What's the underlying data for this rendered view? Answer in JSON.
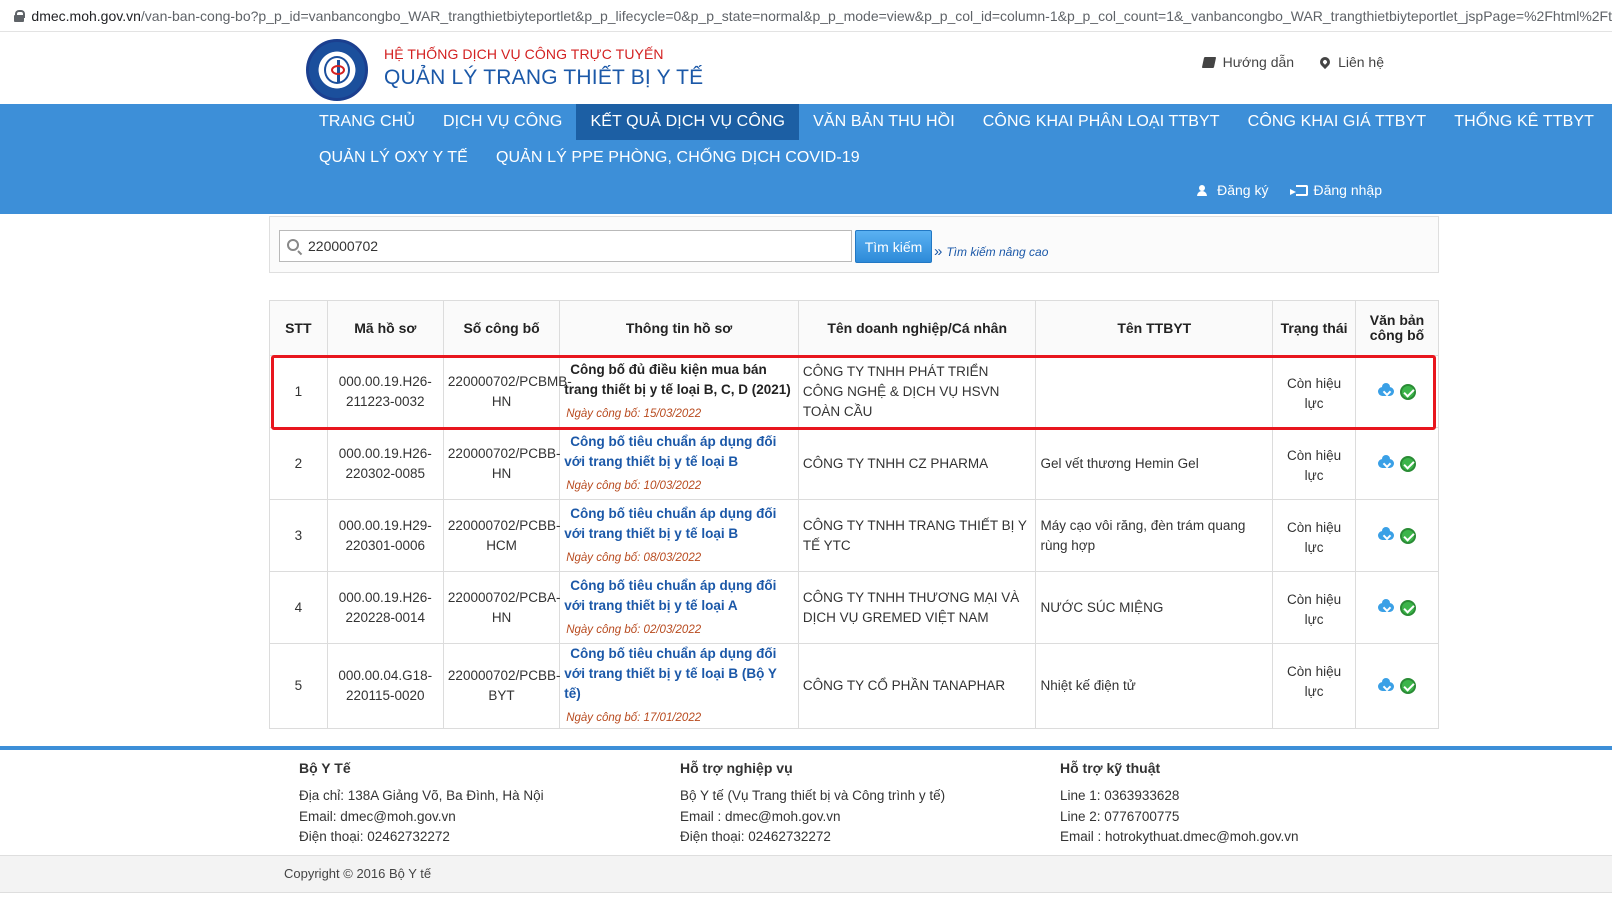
{
  "browser": {
    "url_domain": "dmec.moh.gov.vn",
    "url_rest": "/van-ban-cong-bo?p_p_id=vanbancongbo_WAR_trangthietbiyteportlet&p_p_lifecycle=0&p_p_state=normal&p_p_mode=view&p_p_col_id=column-1&p_p_col_count=1&_vanbancongbo_WAR_trangthietbiyteportlet_jspPage=%2Fhtml%2Ft"
  },
  "header": {
    "subtitle": "HỆ THỐNG DỊCH VỤ CÔNG TRỰC TUYẾN",
    "title": "QUẢN LÝ TRANG THIẾT BỊ Y TẾ",
    "guide": "Hướng dẫn",
    "contact": "Liên hệ"
  },
  "nav": {
    "row1": [
      "TRANG CHỦ",
      "DỊCH VỤ CÔNG",
      "KẾT QUẢ DỊCH VỤ CÔNG",
      "VĂN BẢN THU HỒI",
      "CÔNG KHAI PHÂN LOẠI TTBYT",
      "CÔNG KHAI GIÁ TTBYT",
      "THỐNG KÊ TTBYT"
    ],
    "row2": [
      "QUẢN LÝ OXY Y TẾ",
      "QUẢN LÝ PPE PHÒNG, CHỐNG DỊCH COVID-19"
    ],
    "active": "KẾT QUẢ DỊCH VỤ CÔNG",
    "register": "Đăng ký",
    "login": "Đăng nhập"
  },
  "search": {
    "value": "220000702",
    "button": "Tìm kiếm",
    "advanced": "Tìm kiếm nâng cao"
  },
  "table": {
    "headers": [
      "STT",
      "Mã hồ sơ",
      "Số công bố",
      "Thông tin hồ sơ",
      "Tên doanh nghiệp/Cá nhân",
      "Tên TTBYT",
      "Trạng thái",
      "Văn bản công bố"
    ],
    "rows": [
      {
        "stt": "1",
        "ma": "000.00.19.H26-211223-0032",
        "so": "220000702/PCBMB-HN",
        "title": "Công bố đủ điều kiện mua bán trang thiết bị y tế loại B, C, D (2021)",
        "date": "Ngày công bố: 15/03/2022",
        "company": "CÔNG TY TNHH PHÁT TRIỂN CÔNG NGHỆ & DỊCH VỤ HSVN TOÀN CẦU",
        "device": "",
        "status": "Còn hiệu lực"
      },
      {
        "stt": "2",
        "ma": "000.00.19.H26-220302-0085",
        "so": "220000702/PCBB-HN",
        "title": "Công bố tiêu chuẩn áp dụng đối với trang thiết bị y tế loại B",
        "date": "Ngày công bố: 10/03/2022",
        "company": "CÔNG TY TNHH CZ PHARMA",
        "device": "Gel vết thương Hemin Gel",
        "status": "Còn hiệu lực"
      },
      {
        "stt": "3",
        "ma": "000.00.19.H29-220301-0006",
        "so": "220000702/PCBB-HCM",
        "title": "Công bố tiêu chuẩn áp dụng đối với trang thiết bị y tế loại B",
        "date": "Ngày công bố: 08/03/2022",
        "company": "CÔNG TY TNHH TRANG THIẾT BỊ Y TẾ YTC",
        "device": "Máy cạo vôi răng, đèn trám quang rùng hợp",
        "status": "Còn hiệu lực"
      },
      {
        "stt": "4",
        "ma": "000.00.19.H26-220228-0014",
        "so": "220000702/PCBA-HN",
        "title": "Công bố tiêu chuẩn áp dụng đối với trang thiết bị y tế loại A",
        "date": "Ngày công bố: 02/03/2022",
        "company": "CÔNG TY TNHH THƯƠNG MẠI VÀ DỊCH VỤ GREMED VIỆT NAM",
        "device": "NƯỚC SÚC MIỆNG",
        "status": "Còn hiệu lực"
      },
      {
        "stt": "5",
        "ma": "000.00.04.G18-220115-0020",
        "so": "220000702/PCBB-BYT",
        "title": "Công bố tiêu chuẩn áp dụng đối với trang thiết bị y tế loại B (Bộ Y tế)",
        "date": "Ngày công bố: 17/01/2022",
        "company": "CÔNG TY CỔ PHẦN TANAPHAR",
        "device": "Nhiệt kế điện tử",
        "status": "Còn hiệu lực"
      }
    ]
  },
  "footer": {
    "col1": {
      "title": "Bộ Y Tế",
      "lines": [
        "Địa chỉ: 138A Giảng Võ, Ba Đình, Hà Nội",
        "Email: dmec@moh.gov.vn",
        "Điện thoại: 02462732272"
      ]
    },
    "col2": {
      "title": "Hỗ trợ nghiệp vụ",
      "lines": [
        "Bộ Y tế (Vụ Trang thiết bị và Công trình y tế)",
        "Email : dmec@moh.gov.vn",
        "Điện thoại: 02462732272"
      ]
    },
    "col3": {
      "title": "Hỗ trợ kỹ thuật",
      "lines": [
        "Line 1: 0363933628",
        "Line 2: 0776700775",
        "Email : hotrokythuat.dmec@moh.gov.vn"
      ]
    },
    "copyright": "Copyright © 2016 Bộ Y tế"
  },
  "colors": {
    "nav_bg": "#3d8fd8",
    "nav_active": "#1c5fa4",
    "title_blue": "#1b58a8",
    "subtitle_red": "#d32121",
    "highlight": "#e8161e"
  }
}
